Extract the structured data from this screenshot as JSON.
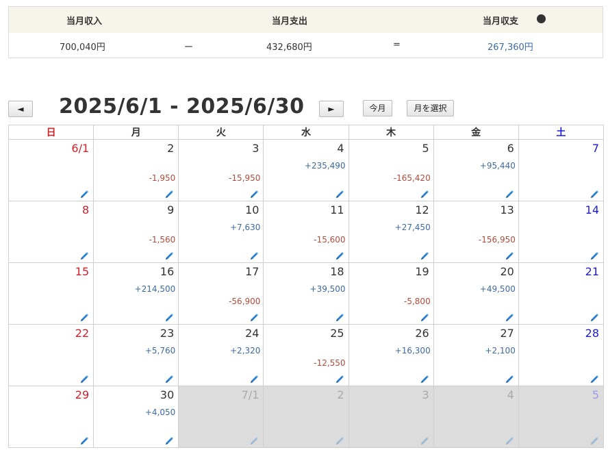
{
  "summary": {
    "income_label": "当月収入",
    "expense_label": "当月支出",
    "balance_label": "当月収支",
    "help_glyph": "?",
    "income_value": "700,040円",
    "minus_sign": "ー",
    "expense_value": "432,680円",
    "equals_sign": "=",
    "balance_value": "267,360円"
  },
  "toolbar": {
    "prev_label": "◄",
    "range_title": "2025/6/1 - 2025/6/30",
    "next_label": "►",
    "this_month_label": "今月",
    "select_month_label": "月を選択"
  },
  "weekdays": [
    "日",
    "月",
    "火",
    "水",
    "木",
    "金",
    "土"
  ],
  "colors": {
    "positive": "#3c6aa3",
    "negative": "#b24a3a",
    "sunday": "#d0202a",
    "saturday": "#1a1ad8"
  },
  "weeks": [
    [
      {
        "day": "6/1",
        "amount": "",
        "sign": "",
        "other": false
      },
      {
        "day": "2",
        "amount": "-1,950",
        "sign": "neg",
        "other": false
      },
      {
        "day": "3",
        "amount": "-15,950",
        "sign": "neg",
        "other": false
      },
      {
        "day": "4",
        "amount": "+235,490",
        "sign": "pos",
        "other": false
      },
      {
        "day": "5",
        "amount": "-165,420",
        "sign": "neg",
        "other": false
      },
      {
        "day": "6",
        "amount": "+95,440",
        "sign": "pos",
        "other": false
      },
      {
        "day": "7",
        "amount": "",
        "sign": "",
        "other": false
      }
    ],
    [
      {
        "day": "8",
        "amount": "",
        "sign": "",
        "other": false
      },
      {
        "day": "9",
        "amount": "-1,560",
        "sign": "neg",
        "other": false
      },
      {
        "day": "10",
        "amount": "+7,630",
        "sign": "pos",
        "other": false
      },
      {
        "day": "11",
        "amount": "-15,600",
        "sign": "neg",
        "other": false
      },
      {
        "day": "12",
        "amount": "+27,450",
        "sign": "pos",
        "other": false
      },
      {
        "day": "13",
        "amount": "-156,950",
        "sign": "neg",
        "other": false
      },
      {
        "day": "14",
        "amount": "",
        "sign": "",
        "other": false
      }
    ],
    [
      {
        "day": "15",
        "amount": "",
        "sign": "",
        "other": false
      },
      {
        "day": "16",
        "amount": "+214,500",
        "sign": "pos",
        "other": false
      },
      {
        "day": "17",
        "amount": "-56,900",
        "sign": "neg",
        "other": false
      },
      {
        "day": "18",
        "amount": "+39,500",
        "sign": "pos",
        "other": false
      },
      {
        "day": "19",
        "amount": "-5,800",
        "sign": "neg",
        "other": false
      },
      {
        "day": "20",
        "amount": "+49,500",
        "sign": "pos",
        "other": false
      },
      {
        "day": "21",
        "amount": "",
        "sign": "",
        "other": false
      }
    ],
    [
      {
        "day": "22",
        "amount": "",
        "sign": "",
        "other": false
      },
      {
        "day": "23",
        "amount": "+5,760",
        "sign": "pos",
        "other": false
      },
      {
        "day": "24",
        "amount": "+2,320",
        "sign": "pos",
        "other": false
      },
      {
        "day": "25",
        "amount": "-12,550",
        "sign": "neg",
        "other": false
      },
      {
        "day": "26",
        "amount": "+16,300",
        "sign": "pos",
        "other": false
      },
      {
        "day": "27",
        "amount": "+2,100",
        "sign": "pos",
        "other": false
      },
      {
        "day": "28",
        "amount": "",
        "sign": "",
        "other": false
      }
    ],
    [
      {
        "day": "29",
        "amount": "",
        "sign": "",
        "other": false
      },
      {
        "day": "30",
        "amount": "+4,050",
        "sign": "pos",
        "other": false
      },
      {
        "day": "7/1",
        "amount": "",
        "sign": "",
        "other": true
      },
      {
        "day": "2",
        "amount": "",
        "sign": "",
        "other": true
      },
      {
        "day": "3",
        "amount": "",
        "sign": "",
        "other": true
      },
      {
        "day": "4",
        "amount": "",
        "sign": "",
        "other": true
      },
      {
        "day": "5",
        "amount": "",
        "sign": "",
        "other": true
      }
    ]
  ]
}
